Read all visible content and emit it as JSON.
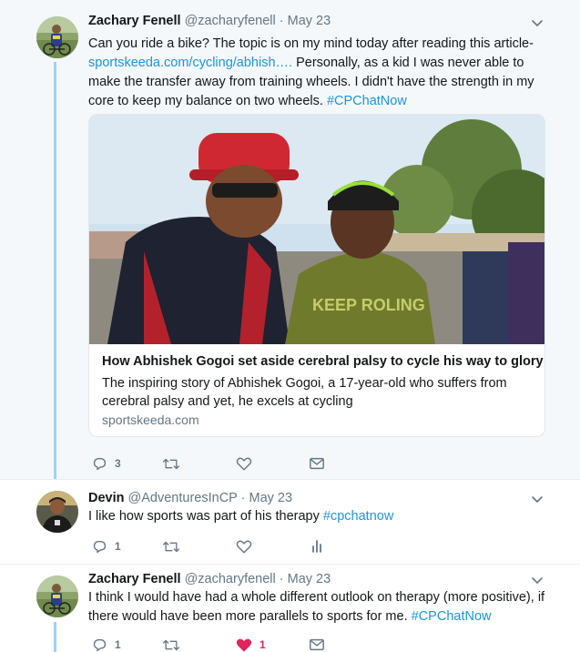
{
  "tweets": [
    {
      "author_name": "Zachary Fenell",
      "handle": "@zacharyfenell",
      "separator": "·",
      "date": "May 23",
      "text_pre": "Can you ride a bike? The topic is on my mind today after reading this article- ",
      "link": "sportskeeda.com/cycling/abhish….",
      "text_post": " Personally, as a kid I was never able to make the transfer away from training wheels. I didn't have the strength in my core to keep my balance on two wheels.  ",
      "hashtag": "#CPChatNow",
      "card": {
        "title": "How Abhishek Gogoi set aside cerebral palsy to cycle his way to glory",
        "description": "The inspiring story of Abhishek Gogoi, a 17-year-old who suffers from cerebral palsy and yet, he excels at cycling",
        "domain": "sportskeeda.com",
        "helmet_text": "KEEP ROLING"
      },
      "reply_count": "3",
      "retweet_count": "",
      "like_count": "",
      "fourth_action_icon": "envelope-icon"
    },
    {
      "author_name": "Devin",
      "handle": "@AdventuresInCP",
      "separator": "·",
      "date": "May 23",
      "text_pre": "I like how sports was part of his therapy ",
      "hashtag": "#cpchatnow",
      "reply_count": "1",
      "retweet_count": "",
      "like_count": "",
      "fourth_action_icon": "analytics-icon"
    },
    {
      "author_name": "Zachary Fenell",
      "handle": "@zacharyfenell",
      "separator": "·",
      "date": "May 23",
      "text_pre": "I think I would have had a whole different outlook on therapy (more positive), if there would have been more parallels to sports for me. ",
      "hashtag": "#CPChatNow",
      "reply_count": "1",
      "retweet_count": "",
      "like_count": "1",
      "liked": true,
      "fourth_action_icon": "envelope-icon"
    }
  ],
  "colors": {
    "link": "#1b95e0",
    "muted": "#657786",
    "like_active": "#e0245e",
    "thread_line": "#9fd2f5",
    "highlight_bg": "#f5f8fa"
  }
}
